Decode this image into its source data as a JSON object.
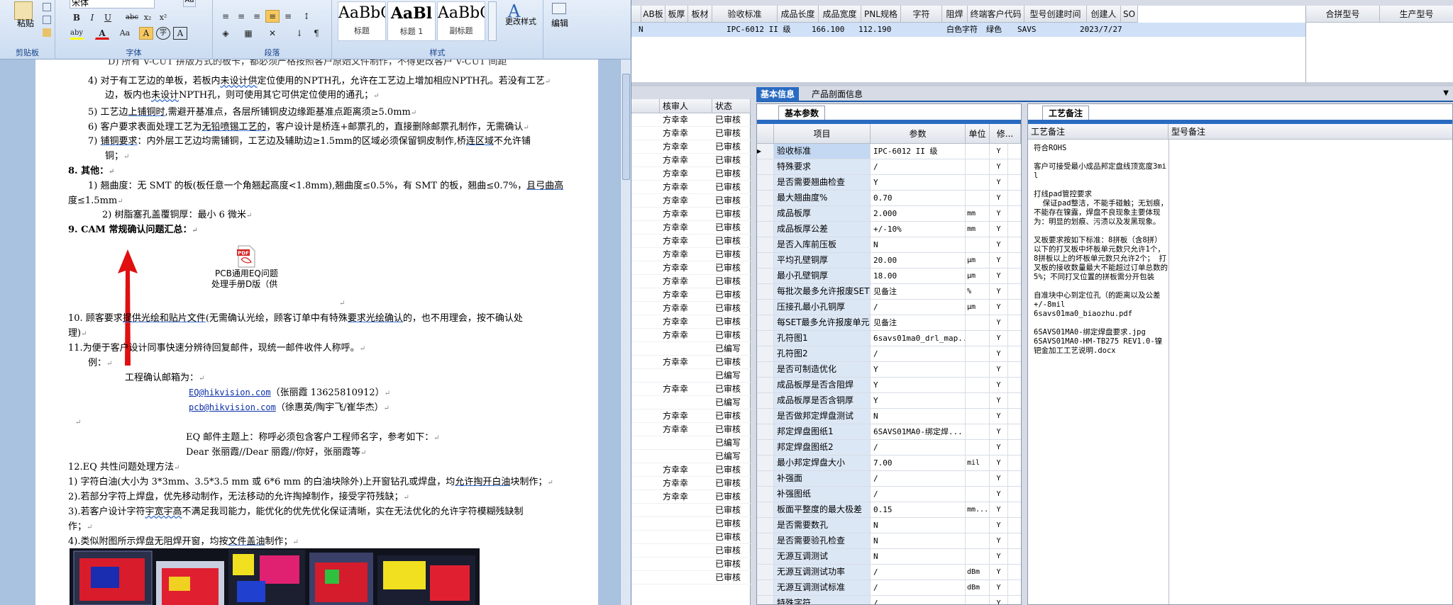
{
  "word": {
    "ribbon": {
      "clipboard": {
        "paste": "粘贴",
        "label": "剪贴板"
      },
      "font": {
        "name": "宋体",
        "label": "字体",
        "bold": "B",
        "italic": "I",
        "underline": "U",
        "strike": "abc",
        "sub": "x₂",
        "sup": "x²",
        "highlight": "aby",
        "color": "A",
        "size_btn": "Aa",
        "clear": "A",
        "circle": "字",
        "border": "A"
      },
      "paragraph": {
        "label": "段落"
      },
      "styles": {
        "label": "样式",
        "items": [
          {
            "big": "AaBbC",
            "small": "标题"
          },
          {
            "big": "AaBl",
            "small": "标题 1"
          },
          {
            "big": "AaBbC",
            "small": "副标题"
          }
        ],
        "change": "更改样式"
      },
      "editing": {
        "label": "编辑"
      }
    },
    "lines": {
      "l0": "D) 所有 V-CUT 拼版方式的板卡，都必须严格按照客户原始文件制作，不得更改客户 V-CUT 间距",
      "l1a": "4)  对于有工艺边的单板，若板内",
      "l1b": "未设计供",
      "l1c": "定位使用的NPTH孔，允许在工艺边上增加相应NPTH孔。若没有工艺",
      "l2a": "边，板内也",
      "l2b": "未设计",
      "l2c": "NPTH孔，则可使用其它可供定位使用的通孔；",
      "l3a": "5)  工艺边",
      "l3b": "上铺铜时",
      "l3c": ",需避开基准点，各层所铺铜皮边缘距基准点距离须≥5.0mm",
      "l4a": "6)  客户要求表面处理工艺为",
      "l4b": "无铅喷锡工艺的",
      "l4c": "，客户设计是桥连+邮票孔的，直接删除邮票孔制作，无需确认",
      "l5a": "7)  ",
      "l5b": "铺铜要求",
      "l5c": "：内外层工艺边均需铺铜，工艺边及辅助边≥1.5mm的区域必须保留铜皮制作,桥",
      "l5d": "连区域",
      "l5e": "不允许铺",
      "l6": "铜；",
      "l7": "8.  其他：",
      "l8a": "1) 翘曲度：无 SMT 的板(板任意一个角翘起高度<1.8mm),翘曲度≤0.5%，有 SMT 的板，翘曲≤0.7%，",
      "l8b": "且弓曲高",
      "l9": "度≤1.5mm",
      "l10": "2) 树脂塞孔盖覆铜厚：最小 6 微米",
      "l11a": "9.  ",
      "l11b": "CAM 常规确认问题汇总：",
      "pdf1": "PCB通用EQ问题",
      "pdf2": "处理手册D版（供",
      "l12a": "10.  顾客要求",
      "l12b": "提供光绘和贴片文件",
      "l12c": "(无需确认光绘，顾客订单中有特殊",
      "l12d": "要求光绘确认",
      "l12e": "的，也不用理会，按不确认处",
      "l13": "理)",
      "l14": "11.为便于客户设计同事快速分辨待回复邮件，现统一邮件收件人称呼。",
      "l15": "例：",
      "l16": "工程确认邮箱为：",
      "mail1": "EQ@hikvision.com",
      "mail1b": "（张丽霞 13625810912）",
      "mail2": "pcb@hikvision.com",
      "mail2b": "（徐惠英/陶宇飞/崔华杰）",
      "l17": "EQ 邮件主题上：称呼必须包含客户工程师名字，参考如下：",
      "l18": "Dear  张丽霞//Dear  丽霞//你好，张丽霞等",
      "l19": "12.EQ 共性问题处理方法",
      "l20a": "1) 字符白油(大小为 3*3mm、3.5*3.5 mm 或 6*6 mm 的白油块除外)上开窗钻孔或焊盘，均",
      "l20b": "允许掏开白油",
      "l20c": "块制作；",
      "l21": "2).若部分字符上焊盘，优先移动制作，无法移动的允许掏掉制作，接受字符残缺；",
      "l22a": "3).若客户设计字符",
      "l22b": "宇宽宇高",
      "l22c": "不满足我司能力，能优化的优先优化保证清晰，实在无法优化的允许字符模糊残缺制",
      "l23": "作；",
      "l24a": "4).类似附图所示焊盘无阻焊开窗，均按",
      "l24b": "文件盖油",
      "l24c": "制作；"
    }
  },
  "app": {
    "top_headers": [
      "AB板",
      "板厚",
      "板材",
      "验收标准",
      "成品长度",
      "成品宽度",
      "PNL规格",
      "字符",
      "阻焊",
      "终端客户代码",
      "型号创建时间",
      "创建人",
      "SO"
    ],
    "top_row": {
      "ab": "N",
      "standard": "IPC-6012 II 级",
      "length": "166.100",
      "width": "112.190",
      "char": "白色字符",
      "mask": "绿色",
      "customer": "SAVS",
      "created": "2023/7/27"
    },
    "right_headers": [
      "合拼型号",
      "生产型号"
    ],
    "check_headers": [
      "核审人",
      "状态"
    ],
    "check_rows": [
      {
        "who": "方幸幸",
        "st": "已审核"
      },
      {
        "who": "方幸幸",
        "st": "已审核"
      },
      {
        "who": "方幸幸",
        "st": "已审核"
      },
      {
        "who": "方幸幸",
        "st": "已审核"
      },
      {
        "who": "方幸幸",
        "st": "已审核"
      },
      {
        "who": "方幸幸",
        "st": "已审核"
      },
      {
        "who": "方幸幸",
        "st": "已审核"
      },
      {
        "who": "方幸幸",
        "st": "已审核"
      },
      {
        "who": "方幸幸",
        "st": "已审核"
      },
      {
        "who": "方幸幸",
        "st": "已审核"
      },
      {
        "who": "方幸幸",
        "st": "已审核"
      },
      {
        "who": "方幸幸",
        "st": "已审核"
      },
      {
        "who": "方幸幸",
        "st": "已审核"
      },
      {
        "who": "方幸幸",
        "st": "已审核"
      },
      {
        "who": "方幸幸",
        "st": "已审核"
      },
      {
        "who": "方幸幸",
        "st": "已审核"
      },
      {
        "who": "方幸幸",
        "st": "已审核"
      },
      {
        "who": "",
        "st": "已编写"
      },
      {
        "who": "方幸幸",
        "st": "已审核"
      },
      {
        "who": "",
        "st": "已编写"
      },
      {
        "who": "方幸幸",
        "st": "已审核"
      },
      {
        "who": "",
        "st": "已编写"
      },
      {
        "who": "方幸幸",
        "st": "已审核"
      },
      {
        "who": "方幸幸",
        "st": "已审核"
      },
      {
        "who": "",
        "st": "已编写"
      },
      {
        "who": "",
        "st": "已编写"
      },
      {
        "who": "方幸幸",
        "st": "已审核"
      },
      {
        "who": "方幸幸",
        "st": "已审核"
      },
      {
        "who": "方幸幸",
        "st": "已审核"
      },
      {
        "who": "",
        "st": "已审核"
      },
      {
        "who": "",
        "st": "已审核"
      },
      {
        "who": "",
        "st": "已审核"
      },
      {
        "who": "",
        "st": "已审核"
      },
      {
        "who": "",
        "st": "已审核"
      },
      {
        "who": "",
        "st": "已审核"
      }
    ],
    "tabs": [
      "基本信息",
      "产品剖面信息"
    ],
    "params_tab": "基本参数",
    "param_headers": [
      "项目",
      "参数",
      "单位",
      "修..."
    ],
    "params": [
      {
        "item": "验收标准",
        "val": "IPC-6012 II 级",
        "unit": "",
        "v": "",
        "y": "Y",
        "cur": true
      },
      {
        "item": "特殊要求",
        "val": "/",
        "unit": "",
        "v": "",
        "y": "Y"
      },
      {
        "item": "是否需要翘曲检查",
        "val": "Y",
        "unit": "",
        "v": "",
        "y": "Y"
      },
      {
        "item": "最大翘曲度%",
        "val": "0.70",
        "unit": "",
        "v": "",
        "y": "Y"
      },
      {
        "item": "成品板厚",
        "val": "2.000",
        "unit": "mm",
        "v": "",
        "y": "Y"
      },
      {
        "item": "成品板厚公差",
        "val": "+/-10%",
        "unit": "mm",
        "v": "",
        "y": "Y"
      },
      {
        "item": "是否入库前压板",
        "val": "N",
        "unit": "",
        "v": "",
        "y": "Y"
      },
      {
        "item": "平均孔壁铜厚",
        "val": "20.00",
        "unit": "μm",
        "v": "",
        "y": "Y"
      },
      {
        "item": "最小孔壁铜厚",
        "val": "18.00",
        "unit": "μm",
        "v": "",
        "y": "Y"
      },
      {
        "item": "每批次最多允许报废SET",
        "val": "见备注",
        "unit": "%",
        "v": "",
        "y": "Y"
      },
      {
        "item": "压接孔最小孔铜厚",
        "val": "/",
        "unit": "μm",
        "v": "",
        "y": "Y"
      },
      {
        "item": "每SET最多允许报废单元",
        "val": "见备注",
        "unit": "",
        "v": "",
        "y": "Y"
      },
      {
        "item": "孔符图1",
        "val": "6savs01ma0_drl_map...",
        "unit": "",
        "v": "",
        "y": "Y"
      },
      {
        "item": "孔符图2",
        "val": "/",
        "unit": "",
        "v": "",
        "y": "Y"
      },
      {
        "item": "是否可制造优化",
        "val": "Y",
        "unit": "",
        "v": "",
        "y": "Y"
      },
      {
        "item": "成品板厚是否含阻焊",
        "val": "Y",
        "unit": "",
        "v": "",
        "y": "Y"
      },
      {
        "item": "成品板厚是否含铜厚",
        "val": "Y",
        "unit": "",
        "v": "",
        "y": "Y"
      },
      {
        "item": "是否做邦定焊盘测试",
        "val": "N",
        "unit": "",
        "v": "",
        "y": "Y"
      },
      {
        "item": "邦定焊盘图纸1",
        "val": "6SAVS01MA0-绑定焊...",
        "unit": "",
        "v": "",
        "y": "Y"
      },
      {
        "item": "邦定焊盘图纸2",
        "val": "/",
        "unit": "",
        "v": "",
        "y": "Y"
      },
      {
        "item": "最小邦定焊盘大小",
        "val": "7.00",
        "unit": "mil",
        "v": "",
        "y": "Y"
      },
      {
        "item": "补强面",
        "val": "/",
        "unit": "",
        "v": "",
        "y": "Y"
      },
      {
        "item": "补强图纸",
        "val": "/",
        "unit": "",
        "v": "",
        "y": "Y"
      },
      {
        "item": "板面平整度的最大极差",
        "val": "0.15",
        "unit": "mm...",
        "v": "",
        "y": "Y"
      },
      {
        "item": "是否需要数孔",
        "val": "N",
        "unit": "",
        "v": "",
        "y": "Y"
      },
      {
        "item": "是否需要验孔检查",
        "val": "N",
        "unit": "",
        "v": "",
        "y": "Y"
      },
      {
        "item": "无源互调测试",
        "val": "N",
        "unit": "",
        "v": "",
        "y": "Y"
      },
      {
        "item": "无源互调测试功率",
        "val": "/",
        "unit": "dBm",
        "v": "",
        "y": "Y"
      },
      {
        "item": "无源互调测试标准",
        "val": "/",
        "unit": "dBm",
        "v": "",
        "y": "Y"
      },
      {
        "item": "特殊字符",
        "val": "/",
        "unit": "",
        "v": "",
        "y": "Y"
      }
    ],
    "notes_tab": "工艺备注",
    "notes_headers": [
      "工艺备注",
      "型号备注"
    ],
    "notes": [
      "符合ROHS",
      "客户可接受最小成品邦定盘线顶宽度3mil",
      "打线pad管控要求\n  保证pad整洁，不能手碰触；无划痕，不能存在镍露，焊盘不良现象主要体现为：明显的划痕、污渍以及发黑现象。",
      "叉板要求按如下标准：8拼板（含8拼）以下的打叉板中坏板单元数只允许1个，8拼板以上的坏板单元数只允许2个； 打叉板的接收数量最大不能超过订单总数的5%；不同打叉位置的拼板需分开包装",
      "自准块中心到定位孔（的距离以及公差+/-8mil\n6savs01ma0_biaozhu.pdf",
      "6SAVS01MA0-绑定焊盘要求.jpg\n6SAVS01MA0-HM-TB275 REV1.0-镍钯金加工工艺说明.docx"
    ]
  }
}
